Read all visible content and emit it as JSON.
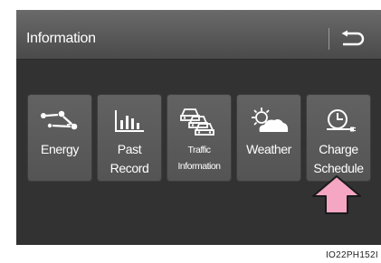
{
  "header": {
    "title": "Information",
    "back_icon": "return-arrow-icon"
  },
  "tiles": [
    {
      "id": "energy",
      "lines": [
        "Energy"
      ],
      "icon": "energy-flow-icon"
    },
    {
      "id": "past-record",
      "lines": [
        "Past",
        "Record"
      ],
      "icon": "bar-chart-icon"
    },
    {
      "id": "traffic-information",
      "lines": [
        "Traffic",
        "Information"
      ],
      "icon": "traffic-cars-icon"
    },
    {
      "id": "weather",
      "lines": [
        "Weather"
      ],
      "icon": "sun-cloud-icon"
    },
    {
      "id": "charge-schedule",
      "lines": [
        "Charge",
        "Schedule"
      ],
      "icon": "clock-plug-icon"
    }
  ],
  "callout": {
    "icon": "pink-up-arrow-icon",
    "color": "#f4a6c3"
  },
  "figure_code": "IO22PH152I"
}
